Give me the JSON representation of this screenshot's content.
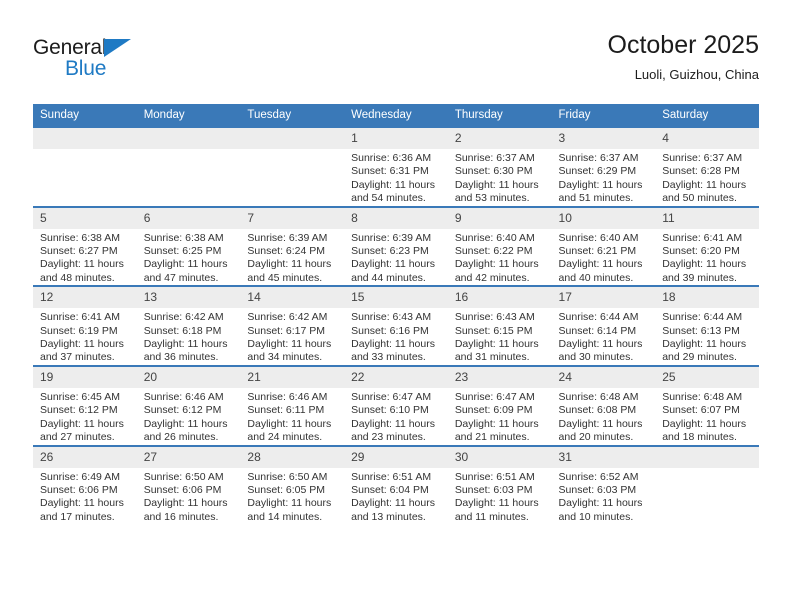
{
  "brand": {
    "name_top": "General",
    "name_bottom": "Blue",
    "accent_color": "#1f7ac4"
  },
  "header": {
    "title": "October 2025",
    "subtitle": "Luoli, Guizhou, China"
  },
  "calendar": {
    "header_color": "#3a79b8",
    "daynum_bg": "#ededed",
    "weekdays": [
      "Sunday",
      "Monday",
      "Tuesday",
      "Wednesday",
      "Thursday",
      "Friday",
      "Saturday"
    ],
    "weeks": [
      [
        {
          "empty": true
        },
        {
          "empty": true
        },
        {
          "empty": true
        },
        {
          "day": "1",
          "sunrise": "Sunrise: 6:36 AM",
          "sunset": "Sunset: 6:31 PM",
          "daylight_1": "Daylight: 11 hours",
          "daylight_2": "and 54 minutes."
        },
        {
          "day": "2",
          "sunrise": "Sunrise: 6:37 AM",
          "sunset": "Sunset: 6:30 PM",
          "daylight_1": "Daylight: 11 hours",
          "daylight_2": "and 53 minutes."
        },
        {
          "day": "3",
          "sunrise": "Sunrise: 6:37 AM",
          "sunset": "Sunset: 6:29 PM",
          "daylight_1": "Daylight: 11 hours",
          "daylight_2": "and 51 minutes."
        },
        {
          "day": "4",
          "sunrise": "Sunrise: 6:37 AM",
          "sunset": "Sunset: 6:28 PM",
          "daylight_1": "Daylight: 11 hours",
          "daylight_2": "and 50 minutes."
        }
      ],
      [
        {
          "day": "5",
          "sunrise": "Sunrise: 6:38 AM",
          "sunset": "Sunset: 6:27 PM",
          "daylight_1": "Daylight: 11 hours",
          "daylight_2": "and 48 minutes."
        },
        {
          "day": "6",
          "sunrise": "Sunrise: 6:38 AM",
          "sunset": "Sunset: 6:25 PM",
          "daylight_1": "Daylight: 11 hours",
          "daylight_2": "and 47 minutes."
        },
        {
          "day": "7",
          "sunrise": "Sunrise: 6:39 AM",
          "sunset": "Sunset: 6:24 PM",
          "daylight_1": "Daylight: 11 hours",
          "daylight_2": "and 45 minutes."
        },
        {
          "day": "8",
          "sunrise": "Sunrise: 6:39 AM",
          "sunset": "Sunset: 6:23 PM",
          "daylight_1": "Daylight: 11 hours",
          "daylight_2": "and 44 minutes."
        },
        {
          "day": "9",
          "sunrise": "Sunrise: 6:40 AM",
          "sunset": "Sunset: 6:22 PM",
          "daylight_1": "Daylight: 11 hours",
          "daylight_2": "and 42 minutes."
        },
        {
          "day": "10",
          "sunrise": "Sunrise: 6:40 AM",
          "sunset": "Sunset: 6:21 PM",
          "daylight_1": "Daylight: 11 hours",
          "daylight_2": "and 40 minutes."
        },
        {
          "day": "11",
          "sunrise": "Sunrise: 6:41 AM",
          "sunset": "Sunset: 6:20 PM",
          "daylight_1": "Daylight: 11 hours",
          "daylight_2": "and 39 minutes."
        }
      ],
      [
        {
          "day": "12",
          "sunrise": "Sunrise: 6:41 AM",
          "sunset": "Sunset: 6:19 PM",
          "daylight_1": "Daylight: 11 hours",
          "daylight_2": "and 37 minutes."
        },
        {
          "day": "13",
          "sunrise": "Sunrise: 6:42 AM",
          "sunset": "Sunset: 6:18 PM",
          "daylight_1": "Daylight: 11 hours",
          "daylight_2": "and 36 minutes."
        },
        {
          "day": "14",
          "sunrise": "Sunrise: 6:42 AM",
          "sunset": "Sunset: 6:17 PM",
          "daylight_1": "Daylight: 11 hours",
          "daylight_2": "and 34 minutes."
        },
        {
          "day": "15",
          "sunrise": "Sunrise: 6:43 AM",
          "sunset": "Sunset: 6:16 PM",
          "daylight_1": "Daylight: 11 hours",
          "daylight_2": "and 33 minutes."
        },
        {
          "day": "16",
          "sunrise": "Sunrise: 6:43 AM",
          "sunset": "Sunset: 6:15 PM",
          "daylight_1": "Daylight: 11 hours",
          "daylight_2": "and 31 minutes."
        },
        {
          "day": "17",
          "sunrise": "Sunrise: 6:44 AM",
          "sunset": "Sunset: 6:14 PM",
          "daylight_1": "Daylight: 11 hours",
          "daylight_2": "and 30 minutes."
        },
        {
          "day": "18",
          "sunrise": "Sunrise: 6:44 AM",
          "sunset": "Sunset: 6:13 PM",
          "daylight_1": "Daylight: 11 hours",
          "daylight_2": "and 29 minutes."
        }
      ],
      [
        {
          "day": "19",
          "sunrise": "Sunrise: 6:45 AM",
          "sunset": "Sunset: 6:12 PM",
          "daylight_1": "Daylight: 11 hours",
          "daylight_2": "and 27 minutes."
        },
        {
          "day": "20",
          "sunrise": "Sunrise: 6:46 AM",
          "sunset": "Sunset: 6:12 PM",
          "daylight_1": "Daylight: 11 hours",
          "daylight_2": "and 26 minutes."
        },
        {
          "day": "21",
          "sunrise": "Sunrise: 6:46 AM",
          "sunset": "Sunset: 6:11 PM",
          "daylight_1": "Daylight: 11 hours",
          "daylight_2": "and 24 minutes."
        },
        {
          "day": "22",
          "sunrise": "Sunrise: 6:47 AM",
          "sunset": "Sunset: 6:10 PM",
          "daylight_1": "Daylight: 11 hours",
          "daylight_2": "and 23 minutes."
        },
        {
          "day": "23",
          "sunrise": "Sunrise: 6:47 AM",
          "sunset": "Sunset: 6:09 PM",
          "daylight_1": "Daylight: 11 hours",
          "daylight_2": "and 21 minutes."
        },
        {
          "day": "24",
          "sunrise": "Sunrise: 6:48 AM",
          "sunset": "Sunset: 6:08 PM",
          "daylight_1": "Daylight: 11 hours",
          "daylight_2": "and 20 minutes."
        },
        {
          "day": "25",
          "sunrise": "Sunrise: 6:48 AM",
          "sunset": "Sunset: 6:07 PM",
          "daylight_1": "Daylight: 11 hours",
          "daylight_2": "and 18 minutes."
        }
      ],
      [
        {
          "day": "26",
          "sunrise": "Sunrise: 6:49 AM",
          "sunset": "Sunset: 6:06 PM",
          "daylight_1": "Daylight: 11 hours",
          "daylight_2": "and 17 minutes."
        },
        {
          "day": "27",
          "sunrise": "Sunrise: 6:50 AM",
          "sunset": "Sunset: 6:06 PM",
          "daylight_1": "Daylight: 11 hours",
          "daylight_2": "and 16 minutes."
        },
        {
          "day": "28",
          "sunrise": "Sunrise: 6:50 AM",
          "sunset": "Sunset: 6:05 PM",
          "daylight_1": "Daylight: 11 hours",
          "daylight_2": "and 14 minutes."
        },
        {
          "day": "29",
          "sunrise": "Sunrise: 6:51 AM",
          "sunset": "Sunset: 6:04 PM",
          "daylight_1": "Daylight: 11 hours",
          "daylight_2": "and 13 minutes."
        },
        {
          "day": "30",
          "sunrise": "Sunrise: 6:51 AM",
          "sunset": "Sunset: 6:03 PM",
          "daylight_1": "Daylight: 11 hours",
          "daylight_2": "and 11 minutes."
        },
        {
          "day": "31",
          "sunrise": "Sunrise: 6:52 AM",
          "sunset": "Sunset: 6:03 PM",
          "daylight_1": "Daylight: 11 hours",
          "daylight_2": "and 10 minutes."
        },
        {
          "empty": true
        }
      ]
    ]
  }
}
